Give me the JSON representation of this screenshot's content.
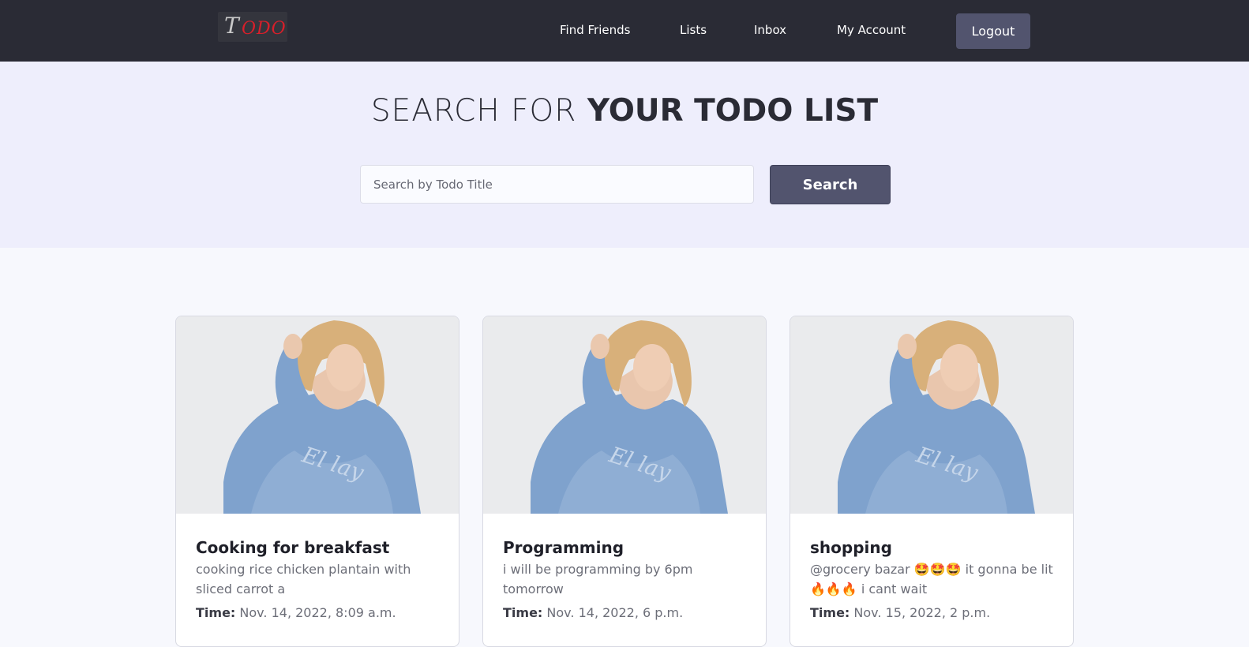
{
  "navbar": {
    "logo": {
      "first_letter": "T",
      "rest": "ODO"
    },
    "links": [
      {
        "label": "Find Friends"
      },
      {
        "label": "Lists"
      },
      {
        "label": "Inbox"
      },
      {
        "label": "My Account"
      }
    ],
    "logout_label": "Logout"
  },
  "hero": {
    "title_light": "SEARCH FOR",
    "title_bold": "YOUR TODO LIST",
    "search_placeholder": "Search by Todo Title",
    "search_button_label": "Search"
  },
  "cards": [
    {
      "title": "Cooking for breakfast",
      "description": "cooking rice chicken plantain with sliced carrot a",
      "time_label": "Time:",
      "time_value": "Nov. 14, 2022, 8:09 a.m."
    },
    {
      "title": "Programming",
      "description": "i will be programming by 6pm tomorrow",
      "time_label": "Time:",
      "time_value": "Nov. 14, 2022, 6 p.m."
    },
    {
      "title": "shopping",
      "description": "@grocery bazar 🤩🤩🤩 it gonna be lit 🔥🔥🔥 i cant wait",
      "time_label": "Time:",
      "time_value": "Nov. 15, 2022, 2 p.m."
    }
  ],
  "colors": {
    "navbar_bg": "#2a2b35",
    "hero_bg": "#eeeefc",
    "button_bg": "#52546e",
    "page_bg": "#f7f8fd"
  }
}
